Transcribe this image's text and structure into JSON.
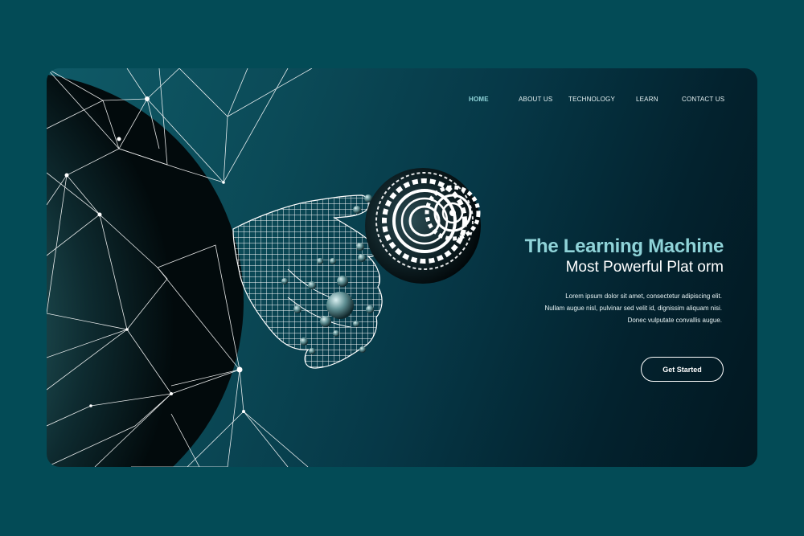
{
  "nav": {
    "items": [
      {
        "label": "HOME",
        "active": true
      },
      {
        "label": "ABOUT US",
        "active": false
      },
      {
        "label": "TECHNOLOGY",
        "active": false
      },
      {
        "label": "LEARN",
        "active": false
      },
      {
        "label": "CONTACT US",
        "active": false
      }
    ]
  },
  "hero": {
    "title": "The Learning Machine",
    "subtitle": "Most Powerful Plat orm",
    "body": [
      "Lorem ipsum dolor sit amet, consectetur adipiscing elit.",
      "Nullam augue nisl, pulvinar sed velit id, dignissim aliquam nisi.",
      "Donec vulputate convallis augue."
    ],
    "cta_label": "Get Started"
  },
  "illustration": {
    "sphere": "wireframe-network-sphere",
    "hand": "wireframe-robot-hand-icon",
    "gears": "gear-icon"
  },
  "colors": {
    "page_background": "#034b56",
    "accent": "#8fd3d8",
    "card_dark": "#021720",
    "text": "#ffffff"
  }
}
